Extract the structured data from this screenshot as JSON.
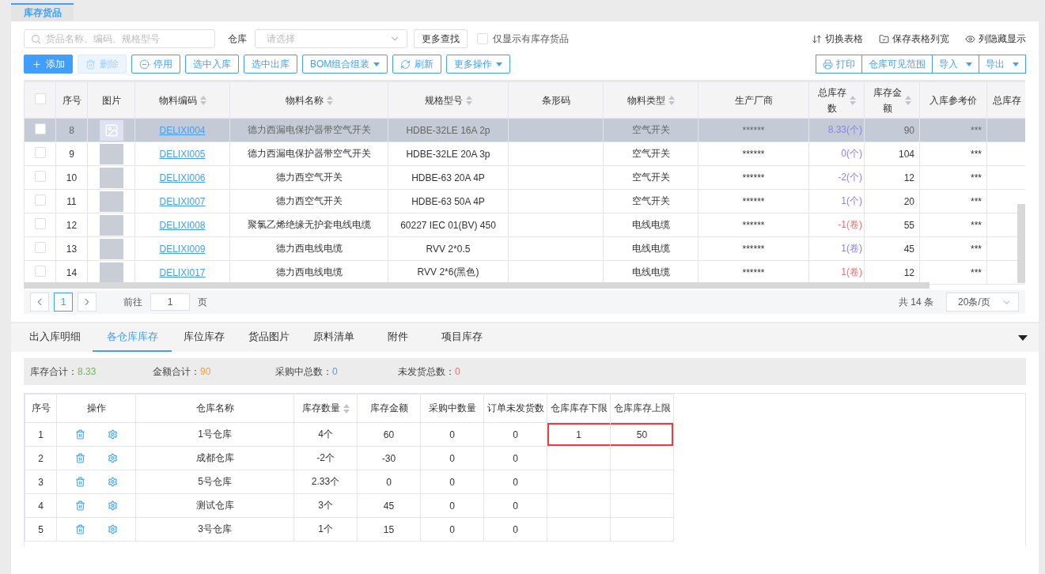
{
  "page_tab": {
    "label": "库存货品",
    "selected": true
  },
  "filters": {
    "search_placeholder": "货品名称、编码、规格型号",
    "warehouse_label": "仓库",
    "warehouse_placeholder": "请选择",
    "more_search": "更多查找",
    "only_in_stock": {
      "label": "仅显示有库存货品",
      "checked": false
    }
  },
  "view_links": [
    {
      "label": "切换表格"
    },
    {
      "label": "保存表格列宽"
    },
    {
      "label": "列隐藏显示"
    }
  ],
  "actions": [
    {
      "label": "添加",
      "kind": "primary",
      "disabled": false,
      "dropdown": false
    },
    {
      "label": "删除",
      "kind": "outline",
      "disabled": true,
      "dropdown": false
    },
    {
      "label": "停用",
      "kind": "outline",
      "disabled": false,
      "dropdown": false
    },
    {
      "label": "选中入库",
      "kind": "outline",
      "disabled": false,
      "dropdown": false
    },
    {
      "label": "选中出库",
      "kind": "outline",
      "disabled": false,
      "dropdown": false
    },
    {
      "label": "BOM组合组装",
      "kind": "outline",
      "disabled": false,
      "dropdown": true
    },
    {
      "label": "刷新",
      "kind": "outline",
      "disabled": false,
      "dropdown": false
    },
    {
      "label": "更多操作",
      "kind": "outline",
      "disabled": false,
      "dropdown": true
    }
  ],
  "right_actions": [
    {
      "label": "打印",
      "dropdown": false
    },
    {
      "label": "仓库可见范围",
      "dropdown": false
    },
    {
      "label": "导入",
      "dropdown": true
    },
    {
      "label": "导出",
      "dropdown": true
    }
  ],
  "table": {
    "header_checkbox": {
      "checked": false
    },
    "columns": [
      {
        "label": "序号",
        "sortable": false
      },
      {
        "label": "图片",
        "sortable": false
      },
      {
        "label": "物料编码",
        "sortable": true
      },
      {
        "label": "物料名称",
        "sortable": true
      },
      {
        "label": "规格型号",
        "sortable": true
      },
      {
        "label": "条形码",
        "sortable": false
      },
      {
        "label": "物料类型",
        "sortable": true
      },
      {
        "label": "生产厂商",
        "sortable": false
      },
      {
        "label": "总库存数",
        "sortable": true
      },
      {
        "label": "库存金额",
        "sortable": true
      },
      {
        "label": "入库参考价",
        "sortable": false
      },
      {
        "label": "总库存",
        "sortable": false
      }
    ],
    "rows": [
      {
        "selected": true,
        "checked": false,
        "no": "8",
        "kind": "placeholder",
        "code": "DELIXI004",
        "name": "德力西漏电保护器带空气开关",
        "spec": "HDBE-32LE 16A 2p",
        "type": "空气开关",
        "maker": "******",
        "qty": "8.33(个)",
        "color": "#8c80f0",
        "amount": "90",
        "price": "***"
      },
      {
        "selected": false,
        "checked": false,
        "no": "9",
        "kind": "photo",
        "code": "DELIXI005",
        "name": "德力西漏电保护器带空气开关",
        "spec": "HDBE-32LE 20A 3p",
        "type": "空气开关",
        "maker": "******",
        "qty": "0(个)",
        "color": "#8c80f0",
        "amount": "104",
        "price": "***"
      },
      {
        "selected": false,
        "checked": false,
        "no": "10",
        "kind": "photo",
        "code": "DELIXI006",
        "name": "德力西空气开关",
        "spec": "HDBE-63 20A 4P",
        "type": "空气开关",
        "maker": "******",
        "qty": "-2(个)",
        "color": "#8c80f0",
        "amount": "12",
        "price": "***"
      },
      {
        "selected": false,
        "checked": false,
        "no": "11",
        "kind": "photo",
        "code": "DELIXI007",
        "name": "德力西空气开关",
        "spec": "HDBE-63 50A 4P",
        "type": "空气开关",
        "maker": "******",
        "qty": "1(个)",
        "color": "#8c80f0",
        "amount": "20",
        "price": "***"
      },
      {
        "selected": false,
        "checked": false,
        "no": "12",
        "kind": "photo",
        "code": "DELIXI008",
        "name": "聚氯乙烯绝缘无护套电线电缆",
        "spec": "60227 IEC 01(BV) 450",
        "type": "电线电缆",
        "maker": "******",
        "qty": "-1(卷)",
        "color": "#f56c6c",
        "amount": "55",
        "price": "***"
      },
      {
        "selected": false,
        "checked": false,
        "no": "13",
        "kind": "photo",
        "code": "DELIXI009",
        "name": "德力西电线电缆",
        "spec": "RVV 2*0.5",
        "type": "电线电缆",
        "maker": "******",
        "qty": "1(卷)",
        "color": "#8c80f0",
        "amount": "45",
        "price": "***"
      },
      {
        "selected": false,
        "checked": false,
        "no": "14",
        "kind": "photo",
        "code": "DELIXI017",
        "name": "德力西电线电缆",
        "spec": "RVV 2*6(黑色)",
        "type": "电线电缆",
        "maker": "******",
        "qty": "1(卷)",
        "color": "#f56c6c",
        "amount": "12",
        "price": "***"
      }
    ]
  },
  "pagination": {
    "pages": [
      {
        "label": "1",
        "selected": true
      }
    ],
    "goto_label": "前往",
    "goto_value": "1",
    "page_unit": "页",
    "total": "共 14 条",
    "page_size": "20条/页"
  },
  "detail_tabs": [
    {
      "label": "出入库明细",
      "selected": false
    },
    {
      "label": "各仓库库存",
      "selected": true
    },
    {
      "label": "库位库存",
      "selected": false
    },
    {
      "label": "货品图片",
      "selected": false
    },
    {
      "label": "原料清单",
      "selected": false
    },
    {
      "label": "附件",
      "selected": false
    },
    {
      "label": "项目库存",
      "selected": false
    }
  ],
  "summary": [
    {
      "label": "库存合计：",
      "value": "8.33",
      "color": "#67c23a"
    },
    {
      "label": "金额合计：",
      "value": "90",
      "color": "#e6a23c"
    },
    {
      "label": "采购中总数：",
      "value": "0",
      "color": "#409eff"
    },
    {
      "label": "未发货总数：",
      "value": "0",
      "color": "#f56c6c"
    }
  ],
  "warehouse_table": {
    "columns": [
      {
        "label": "序号",
        "sortable": false
      },
      {
        "label": "操作",
        "sortable": false
      },
      {
        "label": "仓库名称",
        "sortable": false
      },
      {
        "label": "库存数量",
        "sortable": true
      },
      {
        "label": "库存金额",
        "sortable": false
      },
      {
        "label": "采购中数量",
        "sortable": false
      },
      {
        "label": "订单未发货数",
        "sortable": false
      },
      {
        "label": "仓库库存下限",
        "sortable": false
      },
      {
        "label": "仓库库存上限",
        "sortable": false
      }
    ],
    "rows": [
      {
        "no": "1",
        "name": "1号仓库",
        "qty": "4个",
        "amount": "60",
        "purchasing": "0",
        "unshipped": "0",
        "min": "1",
        "max": "50",
        "highlighted": true
      },
      {
        "no": "2",
        "name": "成都仓库",
        "qty": "-2个",
        "amount": "-30",
        "purchasing": "0",
        "unshipped": "0",
        "highlighted": false
      },
      {
        "no": "3",
        "name": "5号仓库",
        "qty": "2.33个",
        "amount": "0",
        "purchasing": "0",
        "unshipped": "0",
        "highlighted": false
      },
      {
        "no": "4",
        "name": "测试仓库",
        "qty": "3个",
        "amount": "45",
        "purchasing": "0",
        "unshipped": "0",
        "highlighted": false
      },
      {
        "no": "5",
        "name": "3号仓库",
        "qty": "1个",
        "amount": "15",
        "purchasing": "0",
        "unshipped": "0",
        "highlighted": false
      }
    ]
  }
}
